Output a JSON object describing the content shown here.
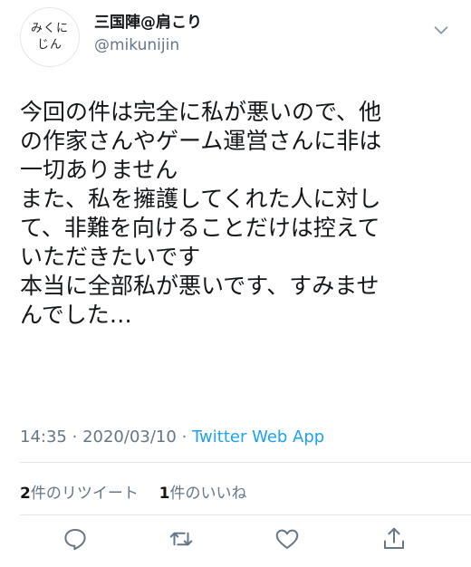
{
  "avatar": {
    "line1": "みくに",
    "line2": "じん"
  },
  "user": {
    "display_name": "三国陣@肩こり",
    "handle": "@mikunijin"
  },
  "tweet": {
    "lines": [
      "今回の件は完全に私が悪いので、他",
      "の作家さんやゲーム運営さんに非は",
      "一切ありません",
      "また、私を擁護してくれた人に対し",
      "て、非難を向けることだけは控えて",
      "いただきたいです",
      "本当に全部私が悪いです、すみませ",
      "んでした…"
    ],
    "time": "14:35",
    "separator": "·",
    "date": "2020/03/10",
    "source": "Twitter Web App"
  },
  "stats": {
    "retweets_count": "2",
    "retweets_label": "件のリツイート",
    "likes_count": "1",
    "likes_label": "件のいいね"
  },
  "icons": {
    "menu": "chevron-down-icon",
    "reply": "reply-icon",
    "retweet": "retweet-icon",
    "like": "heart-icon",
    "share": "share-icon"
  },
  "colors": {
    "link": "#1da1f2",
    "muted": "#657786",
    "text": "#14171a",
    "divider": "#e1e8ed"
  }
}
